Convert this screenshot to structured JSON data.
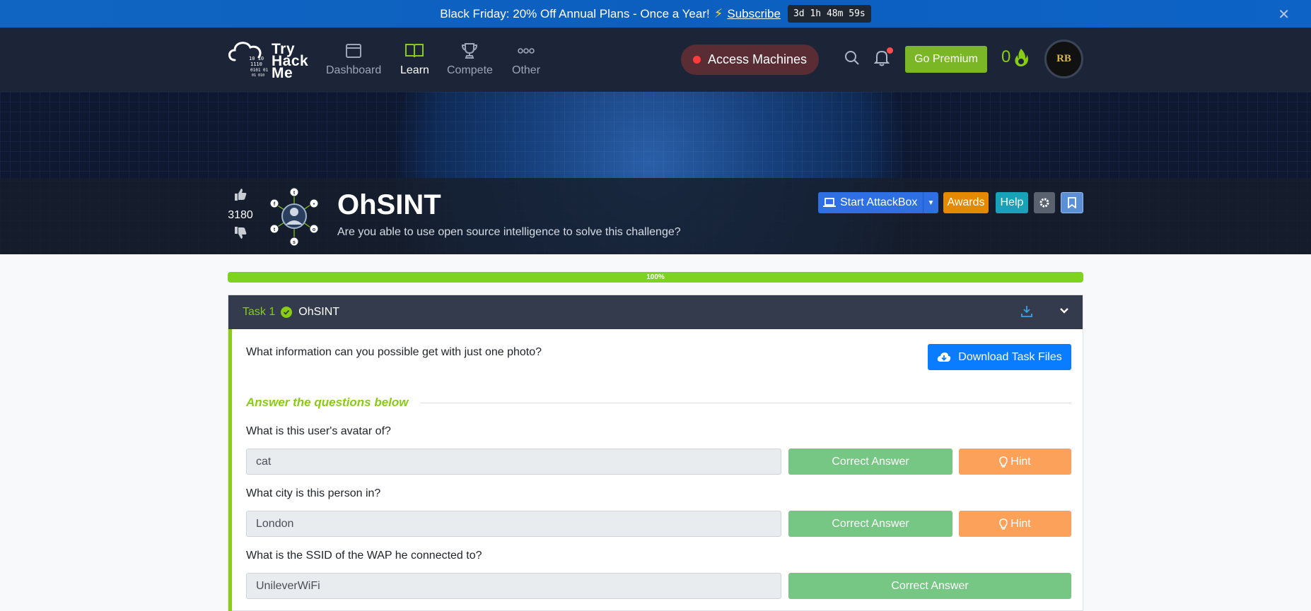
{
  "promo": {
    "text": "Black Friday: 20% Off Annual Plans - Once a Year!",
    "link": "Subscribe",
    "timer": "3d 1h 48m 59s"
  },
  "nav": {
    "brand": [
      "Try",
      "Hack",
      "Me"
    ],
    "items": [
      {
        "label": "Dashboard",
        "icon": "dashboard-icon"
      },
      {
        "label": "Learn",
        "icon": "book-icon"
      },
      {
        "label": "Compete",
        "icon": "trophy-icon"
      },
      {
        "label": "Other",
        "icon": "more-icon"
      }
    ],
    "access_machines": "Access Machines",
    "go_premium": "Go Premium",
    "streak": "0",
    "avatar_initials": "RB"
  },
  "room": {
    "votes": "3180",
    "title": "OhSINT",
    "description": "Are you able to use open source intelligence to solve this challenge?",
    "buttons": {
      "attackbox": "Start AttackBox",
      "awards": "Awards",
      "help": "Help"
    }
  },
  "progress": {
    "label": "100%",
    "value": 100
  },
  "task": {
    "number": "Task 1",
    "title": "OhSINT",
    "text": "What information can you possible get with just one photo?",
    "download_label": "Download Task Files",
    "answers_heading": "Answer the questions below",
    "questions": [
      {
        "question": "What is this user's avatar of?",
        "answer": "cat",
        "status": "Correct Answer",
        "hint": "Hint"
      },
      {
        "question": "What city is this person in?",
        "answer": "London",
        "status": "Correct Answer",
        "hint": "Hint"
      },
      {
        "question": "What is the SSID of the WAP he connected to?",
        "answer": "UnileverWiFi",
        "status": "Correct Answer",
        "hint": ""
      }
    ]
  },
  "colors": {
    "accent_green": "#88cc14",
    "navbar": "#1c2538",
    "correct": "#75c783",
    "hint": "#fba15a",
    "primary_blue": "#0a7cff"
  }
}
